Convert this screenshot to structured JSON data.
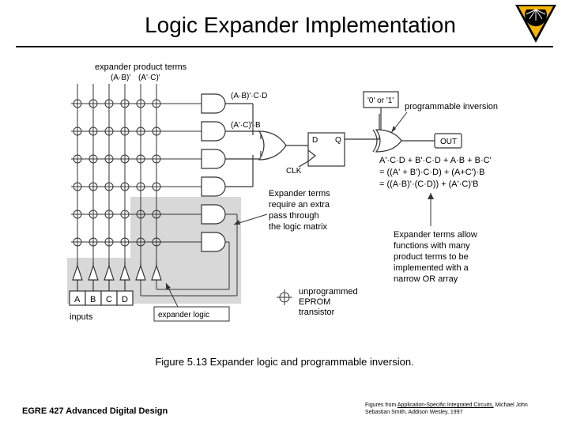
{
  "title": "Logic Expander Implementation",
  "caption": "Figure 5.13  Expander logic and programmable inversion.",
  "footerLeft": "EGRE 427 Advanced Digital Design",
  "footerRightPrefix": "Figures from ",
  "footerRightBook": "Application-Specific Integrated Circuits,",
  "footerRightSuffix": " Michael John Sebastian Smith, Addison Wesley, 1997",
  "labels": {
    "expanderProductTerms": "expander product terms",
    "termAB": "(A·B)'",
    "termAC": "(A'·C)'",
    "gateTop": "(A·B)'·C·D",
    "gateMid": "(A'·C)'·B",
    "zeroOne": "'0' or '1'",
    "progInv": "programmable inversion",
    "out": "OUT",
    "dinput": "D",
    "qoutput": "Q",
    "clk": "CLK",
    "eq1": "A'·C·D + B'·C·D + A·B + B·C'",
    "eq2": "= ((A' + B')·C·D) +  (A+C')·B",
    "eq3": "= ((A·B)'·(C·D)) + (A'·C)'B",
    "expanderNote1": "Expander terms",
    "expanderNote2": "require an extra",
    "expanderNote3": "pass through",
    "expanderNote4": "the logic matrix",
    "allowNote1": "Expander terms allow",
    "allowNote2": "functions with many",
    "allowNote3": "product terms to be",
    "allowNote4": "implemented with a",
    "allowNote5": "narrow OR array",
    "unprog1": "unprogrammed",
    "unprog2": "EPROM",
    "unprog3": "transistor",
    "expanderLogic": "expander logic",
    "inputs": "inputs",
    "inA": "A",
    "inB": "B",
    "inC": "C",
    "inD": "D"
  }
}
